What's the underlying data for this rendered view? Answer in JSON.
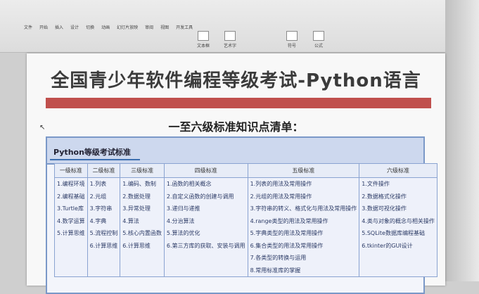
{
  "toolbar": {
    "tabs": [
      "文件",
      "开始",
      "插入",
      "设计",
      "切换",
      "动画",
      "幻灯片放映",
      "审阅",
      "视图",
      "开发工具"
    ],
    "buttons": [
      "文本框",
      "艺术字",
      "符号",
      "公式"
    ]
  },
  "slide": {
    "title": "全国青少年软件编程等级考试-Python语言",
    "subtitle": "一至六级标准知识点清单：",
    "box_title": "Python等级考试标准",
    "headers": [
      "一级标准",
      "二级标准",
      "三级标准",
      "四级标准",
      "五级标准",
      "六级标准"
    ],
    "columns": [
      [
        "1.编程环境",
        "2.编程基础",
        "3.Turtle库",
        "4.数学运算",
        "5.计算思维"
      ],
      [
        "1.列表",
        "2.元组",
        "3.字符串",
        "4.字典",
        "5.流程控制",
        "6.计算思维"
      ],
      [
        "1.编码、数制",
        "2.数据处理",
        "3.异常处理",
        "4.算法",
        "5.核心内置函数",
        "6.计算思维"
      ],
      [
        "1.函数的相关概念",
        "2.自定义函数的创建与调用",
        "3.递归与递推",
        "4.分治算法",
        "5.算法的优化",
        "6.第三方库的获取、安装与调用"
      ],
      [
        "1.列表的用法及常用操作",
        "2.元组的用法及常用操作",
        "3.字符串的转义、格式化与用法及常用操作",
        "4.range类型的用法及常用操作",
        "5.字典类型的用法及常用操作",
        "6.集合类型的用法及常用操作",
        "7.各类型的转换与运用",
        "8.常用标准库的掌握"
      ],
      [
        "1.文件操作",
        "2.数据格式化操作",
        "3.数据可视化操作",
        "4.类与对象的概念与相关操作",
        "5.SQLite数据库编程基础",
        "6.tkinter的GUI设计"
      ]
    ]
  }
}
